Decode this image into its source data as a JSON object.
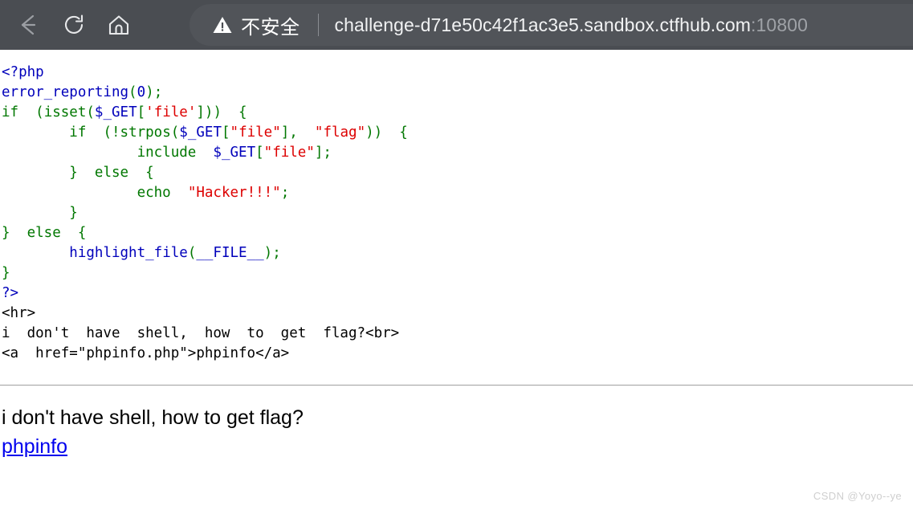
{
  "browser": {
    "back_label": "Back",
    "reload_label": "Reload",
    "home_label": "Home",
    "security_icon": "warning-triangle-icon",
    "security_label": "不安全",
    "url_host": "challenge-d71e50c42f1ac3e5.sandbox.ctfhub.com",
    "url_port": ":10800",
    "toolbar_bg": "#4a4d52",
    "omnibox_bg": "#515459"
  },
  "source_code": {
    "lines": [
      {
        "indent": 0,
        "tokens": [
          {
            "t": "<?php",
            "c": "c-tag"
          }
        ]
      },
      {
        "indent": 0,
        "tokens": [
          {
            "t": "error_reporting",
            "c": "c-fn"
          },
          {
            "t": "(",
            "c": "c-kw"
          },
          {
            "t": "0",
            "c": "c-tag"
          },
          {
            "t": ")",
            "c": "c-kw"
          },
          {
            "t": ";",
            "c": "c-kw"
          }
        ]
      },
      {
        "indent": 0,
        "tokens": [
          {
            "t": "if",
            "c": "c-kw"
          },
          {
            "t": "  (",
            "c": "c-kw"
          },
          {
            "t": "isset",
            "c": "c-kw"
          },
          {
            "t": "(",
            "c": "c-kw"
          },
          {
            "t": "$_GET",
            "c": "c-var"
          },
          {
            "t": "[",
            "c": "c-kw"
          },
          {
            "t": "'file'",
            "c": "c-str"
          },
          {
            "t": "]))  {",
            "c": "c-kw"
          }
        ]
      },
      {
        "indent": 8,
        "tokens": [
          {
            "t": "if",
            "c": "c-kw"
          },
          {
            "t": "  (!",
            "c": "c-kw"
          },
          {
            "t": "strpos",
            "c": "c-kw"
          },
          {
            "t": "(",
            "c": "c-kw"
          },
          {
            "t": "$_GET",
            "c": "c-var"
          },
          {
            "t": "[",
            "c": "c-kw"
          },
          {
            "t": "\"file\"",
            "c": "c-str"
          },
          {
            "t": "],  ",
            "c": "c-kw"
          },
          {
            "t": "\"flag\"",
            "c": "c-str"
          },
          {
            "t": "))  {",
            "c": "c-kw"
          }
        ]
      },
      {
        "indent": 16,
        "tokens": [
          {
            "t": "include",
            "c": "c-kw"
          },
          {
            "t": "  ",
            "c": "c-kw"
          },
          {
            "t": "$_GET",
            "c": "c-var"
          },
          {
            "t": "[",
            "c": "c-kw"
          },
          {
            "t": "\"file\"",
            "c": "c-str"
          },
          {
            "t": "];",
            "c": "c-kw"
          }
        ]
      },
      {
        "indent": 8,
        "tokens": [
          {
            "t": "}  ",
            "c": "c-kw"
          },
          {
            "t": "else",
            "c": "c-kw"
          },
          {
            "t": "  {",
            "c": "c-kw"
          }
        ]
      },
      {
        "indent": 16,
        "tokens": [
          {
            "t": "echo",
            "c": "c-kw"
          },
          {
            "t": "  ",
            "c": "c-kw"
          },
          {
            "t": "\"Hacker!!!\"",
            "c": "c-str"
          },
          {
            "t": ";",
            "c": "c-kw"
          }
        ]
      },
      {
        "indent": 8,
        "tokens": [
          {
            "t": "}",
            "c": "c-kw"
          }
        ]
      },
      {
        "indent": 0,
        "tokens": [
          {
            "t": "}  ",
            "c": "c-kw"
          },
          {
            "t": "else",
            "c": "c-kw"
          },
          {
            "t": "  {",
            "c": "c-kw"
          }
        ]
      },
      {
        "indent": 8,
        "tokens": [
          {
            "t": "highlight_file",
            "c": "c-fn"
          },
          {
            "t": "(",
            "c": "c-kw"
          },
          {
            "t": "__FILE__",
            "c": "c-var"
          },
          {
            "t": ")",
            "c": "c-kw"
          },
          {
            "t": ";",
            "c": "c-kw"
          }
        ]
      },
      {
        "indent": 0,
        "tokens": [
          {
            "t": "}",
            "c": "c-kw"
          }
        ]
      },
      {
        "indent": 0,
        "tokens": [
          {
            "t": "?>",
            "c": "c-tag"
          }
        ]
      },
      {
        "indent": 0,
        "tokens": [
          {
            "t": "<hr>",
            "c": "c-html"
          }
        ]
      },
      {
        "indent": 0,
        "tokens": [
          {
            "t": "i  don't  have  shell,  how  to  get  flag?<br>",
            "c": "c-html"
          }
        ]
      },
      {
        "indent": 0,
        "tokens": [
          {
            "t": "<a  href=\"phpinfo.php\">phpinfo</a>",
            "c": "c-html"
          }
        ]
      }
    ]
  },
  "rendered_output": {
    "message": "i don't have shell, how to get flag?",
    "link_label": "phpinfo"
  },
  "watermark": "CSDN @Yoyo--ye"
}
